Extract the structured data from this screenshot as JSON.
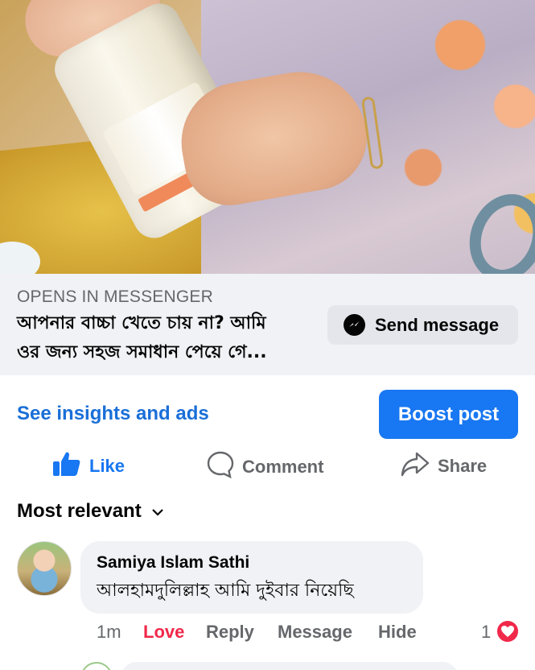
{
  "ad_cta": {
    "opens_label": "OPENS IN MESSENGER",
    "headline_line1": "আপনার বাচ্চা খেতে চায় না? আমি",
    "headline_line2": "ওর জন্য সহজ সমাধান পেয়ে গে...",
    "send_button_label": "Send message"
  },
  "insights": {
    "link_label": "See insights and ads",
    "boost_label": "Boost post"
  },
  "actions": {
    "like_label": "Like",
    "comment_label": "Comment",
    "share_label": "Share"
  },
  "sort": {
    "label": "Most relevant"
  },
  "comment": {
    "author": "Samiya Islam Sathi",
    "text": "আলহামদুলিল্লাহ আমি দুইবার নিয়েছি",
    "time": "1m",
    "love_label": "Love",
    "reply_label": "Reply",
    "message_label": "Message",
    "hide_label": "Hide",
    "reaction_count": "1"
  },
  "colors": {
    "facebook_blue": "#1877f2",
    "love_red": "#f0284a",
    "secondary_text": "#65676b",
    "bubble_bg": "#f0f2f5"
  },
  "icons": {
    "like": "thumbs-up-icon",
    "comment": "speech-bubble-icon",
    "share": "share-arrow-icon",
    "messenger": "messenger-icon",
    "sort": "chevron-down-icon",
    "reaction": "heart-icon"
  }
}
